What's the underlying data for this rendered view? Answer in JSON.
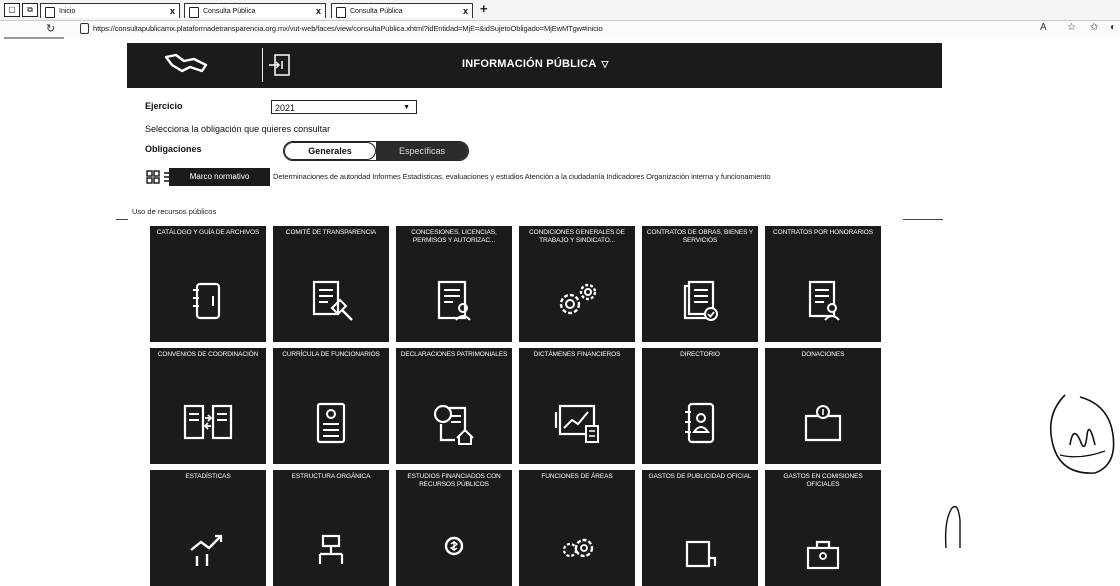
{
  "browser": {
    "tabs": [
      {
        "title": "Inicio",
        "close": "x"
      },
      {
        "title": "Consulta Pública",
        "close": "x"
      },
      {
        "title": "Consulta Pública",
        "close": "x"
      }
    ],
    "new_tab": "+",
    "url": "https://consultapublicamx.plataformadetransparencia.org.mx/vut-web/faces/view/consultaPublica.xhtml?idEntidad=MjE=&idSujetoObligado=MjEwMTgw#inicio"
  },
  "header": {
    "title": "INFORMACIÓN PÚBLICA"
  },
  "filters": {
    "ejercicio_label": "Ejercicio",
    "ejercicio_value": "2021",
    "instruction": "Selecciona la obligación que quieres consultar",
    "obligaciones_label": "Obligaciones",
    "toggle_generales": "Generales",
    "toggle_especificas": "Específicas",
    "active_filter": "Marco normativo",
    "other_filters": "Determinaciones de autoridad  Informes  Estadísticas, evaluaciones y estudios  Atención a la ciudadanía  Indicadores  Organización interna y funcionamiento",
    "section_note": "Uso de recursos públicos"
  },
  "cards": [
    {
      "title": "CATÁLOGO Y GUÍA DE ARCHIVOS",
      "icon": "binder-icon"
    },
    {
      "title": "COMITÉ DE TRANSPARENCIA",
      "icon": "document-gavel-icon"
    },
    {
      "title": "CONCESIONES, LICENCIAS, PERMISOS Y AUTORIZAC...",
      "icon": "document-person-icon"
    },
    {
      "title": "CONDICIONES GENERALES DE TRABAJO Y SINDICATO...",
      "icon": "gears-icon"
    },
    {
      "title": "CONTRATOS DE OBRAS, BIENES Y SERVICIOS",
      "icon": "documents-check-icon"
    },
    {
      "title": "CONTRATOS POR HONORARIOS",
      "icon": "document-user-icon"
    },
    {
      "title": "CONVENIOS DE COORDINACIÓN",
      "icon": "documents-exchange-icon"
    },
    {
      "title": "CURRÍCULA DE FUNCIONARIOS",
      "icon": "id-card-icon"
    },
    {
      "title": "DECLARACIONES PATRIMONIALES",
      "icon": "document-house-icon"
    },
    {
      "title": "DICTÁMENES FINANCIEROS",
      "icon": "chart-calculator-icon"
    },
    {
      "title": "DIRECTORIO",
      "icon": "address-book-icon"
    },
    {
      "title": "DONACIONES",
      "icon": "donation-folder-icon"
    },
    {
      "title": "ESTADÍSTICAS",
      "icon": "trend-chart-icon"
    },
    {
      "title": "ESTRUCTURA ORGÁNICA",
      "icon": "org-chart-icon"
    },
    {
      "title": "ESTUDIOS FINANCIADOS CON RECURSOS PÚBLICOS",
      "icon": "coin-icon"
    },
    {
      "title": "FUNCIONES DE ÁREAS",
      "icon": "gears-icon"
    },
    {
      "title": "GASTOS DE PUBLICIDAD OFICIAL",
      "icon": "billboard-icon"
    },
    {
      "title": "GASTOS EN COMISIONES OFICIALES",
      "icon": "briefcase-icon"
    }
  ]
}
